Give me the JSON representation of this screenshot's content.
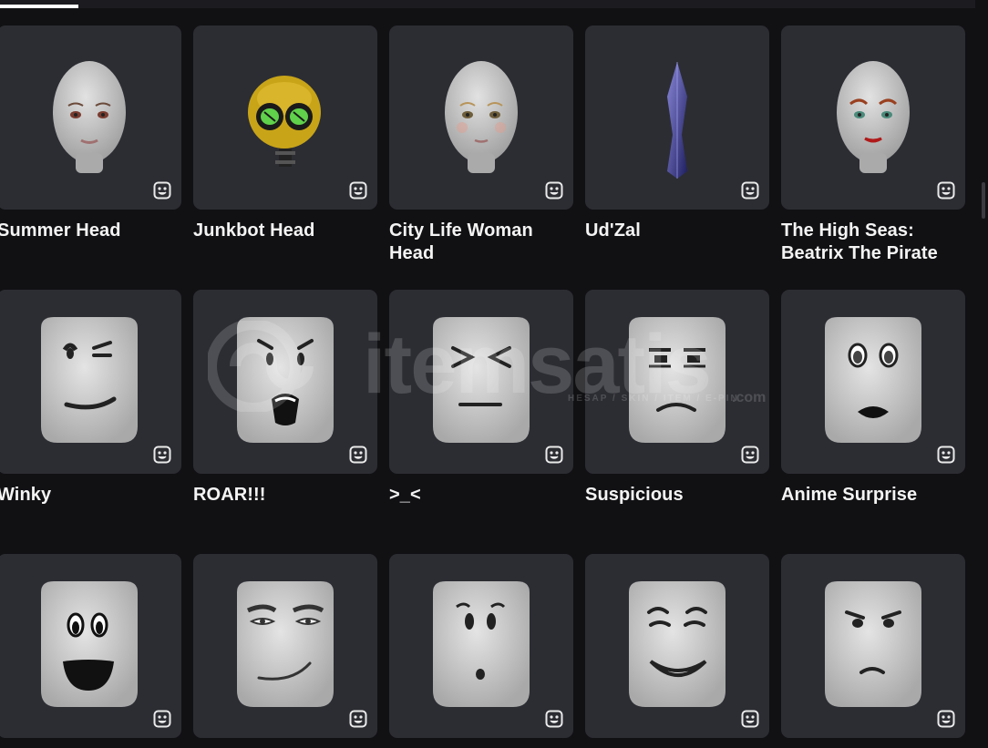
{
  "items": [
    {
      "name": "Summer Head",
      "art": "summer"
    },
    {
      "name": "Junkbot Head",
      "art": "junkbot"
    },
    {
      "name": "City Life Woman Head",
      "art": "citylife"
    },
    {
      "name": "Ud'Zal",
      "art": "udzal"
    },
    {
      "name": "The High Seas: Beatrix The Pirate",
      "art": "beatrix"
    },
    {
      "name": "Winky",
      "art": "winky"
    },
    {
      "name": "ROAR!!!",
      "art": "roar"
    },
    {
      "name": ">_<",
      "art": "squint"
    },
    {
      "name": "Suspicious",
      "art": "suspicious"
    },
    {
      "name": "Anime Surprise",
      "art": "anime"
    },
    {
      "name": "",
      "art": "smile"
    },
    {
      "name": "",
      "art": "mansmile"
    },
    {
      "name": "",
      "art": "oface"
    },
    {
      "name": "",
      "art": "grin"
    },
    {
      "name": "",
      "art": "angry"
    }
  ],
  "watermark": {
    "brand": "itemsatis",
    "tagline": "HESAP / SKIN / ITEM / E-PIN",
    "domain": ".com"
  },
  "badge_icon": "dynamic-head-icon"
}
